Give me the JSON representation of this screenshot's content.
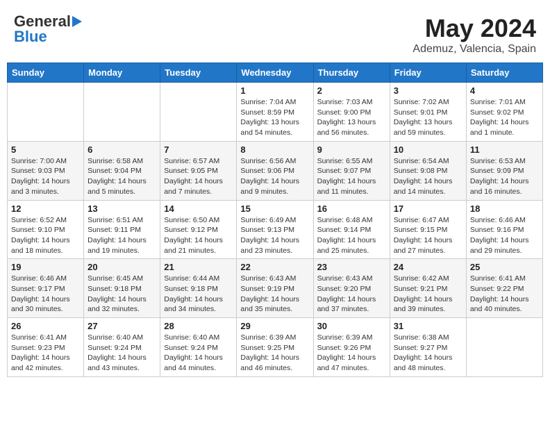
{
  "header": {
    "logo_general": "General",
    "logo_blue": "Blue",
    "month_title": "May 2024",
    "location": "Ademuz, Valencia, Spain"
  },
  "days_of_week": [
    "Sunday",
    "Monday",
    "Tuesday",
    "Wednesday",
    "Thursday",
    "Friday",
    "Saturday"
  ],
  "weeks": [
    [
      {
        "day": "",
        "info": ""
      },
      {
        "day": "",
        "info": ""
      },
      {
        "day": "",
        "info": ""
      },
      {
        "day": "1",
        "info": "Sunrise: 7:04 AM\nSunset: 8:59 PM\nDaylight: 13 hours\nand 54 minutes."
      },
      {
        "day": "2",
        "info": "Sunrise: 7:03 AM\nSunset: 9:00 PM\nDaylight: 13 hours\nand 56 minutes."
      },
      {
        "day": "3",
        "info": "Sunrise: 7:02 AM\nSunset: 9:01 PM\nDaylight: 13 hours\nand 59 minutes."
      },
      {
        "day": "4",
        "info": "Sunrise: 7:01 AM\nSunset: 9:02 PM\nDaylight: 14 hours\nand 1 minute."
      }
    ],
    [
      {
        "day": "5",
        "info": "Sunrise: 7:00 AM\nSunset: 9:03 PM\nDaylight: 14 hours\nand 3 minutes."
      },
      {
        "day": "6",
        "info": "Sunrise: 6:58 AM\nSunset: 9:04 PM\nDaylight: 14 hours\nand 5 minutes."
      },
      {
        "day": "7",
        "info": "Sunrise: 6:57 AM\nSunset: 9:05 PM\nDaylight: 14 hours\nand 7 minutes."
      },
      {
        "day": "8",
        "info": "Sunrise: 6:56 AM\nSunset: 9:06 PM\nDaylight: 14 hours\nand 9 minutes."
      },
      {
        "day": "9",
        "info": "Sunrise: 6:55 AM\nSunset: 9:07 PM\nDaylight: 14 hours\nand 11 minutes."
      },
      {
        "day": "10",
        "info": "Sunrise: 6:54 AM\nSunset: 9:08 PM\nDaylight: 14 hours\nand 14 minutes."
      },
      {
        "day": "11",
        "info": "Sunrise: 6:53 AM\nSunset: 9:09 PM\nDaylight: 14 hours\nand 16 minutes."
      }
    ],
    [
      {
        "day": "12",
        "info": "Sunrise: 6:52 AM\nSunset: 9:10 PM\nDaylight: 14 hours\nand 18 minutes."
      },
      {
        "day": "13",
        "info": "Sunrise: 6:51 AM\nSunset: 9:11 PM\nDaylight: 14 hours\nand 19 minutes."
      },
      {
        "day": "14",
        "info": "Sunrise: 6:50 AM\nSunset: 9:12 PM\nDaylight: 14 hours\nand 21 minutes."
      },
      {
        "day": "15",
        "info": "Sunrise: 6:49 AM\nSunset: 9:13 PM\nDaylight: 14 hours\nand 23 minutes."
      },
      {
        "day": "16",
        "info": "Sunrise: 6:48 AM\nSunset: 9:14 PM\nDaylight: 14 hours\nand 25 minutes."
      },
      {
        "day": "17",
        "info": "Sunrise: 6:47 AM\nSunset: 9:15 PM\nDaylight: 14 hours\nand 27 minutes."
      },
      {
        "day": "18",
        "info": "Sunrise: 6:46 AM\nSunset: 9:16 PM\nDaylight: 14 hours\nand 29 minutes."
      }
    ],
    [
      {
        "day": "19",
        "info": "Sunrise: 6:46 AM\nSunset: 9:17 PM\nDaylight: 14 hours\nand 30 minutes."
      },
      {
        "day": "20",
        "info": "Sunrise: 6:45 AM\nSunset: 9:18 PM\nDaylight: 14 hours\nand 32 minutes."
      },
      {
        "day": "21",
        "info": "Sunrise: 6:44 AM\nSunset: 9:18 PM\nDaylight: 14 hours\nand 34 minutes."
      },
      {
        "day": "22",
        "info": "Sunrise: 6:43 AM\nSunset: 9:19 PM\nDaylight: 14 hours\nand 35 minutes."
      },
      {
        "day": "23",
        "info": "Sunrise: 6:43 AM\nSunset: 9:20 PM\nDaylight: 14 hours\nand 37 minutes."
      },
      {
        "day": "24",
        "info": "Sunrise: 6:42 AM\nSunset: 9:21 PM\nDaylight: 14 hours\nand 39 minutes."
      },
      {
        "day": "25",
        "info": "Sunrise: 6:41 AM\nSunset: 9:22 PM\nDaylight: 14 hours\nand 40 minutes."
      }
    ],
    [
      {
        "day": "26",
        "info": "Sunrise: 6:41 AM\nSunset: 9:23 PM\nDaylight: 14 hours\nand 42 minutes."
      },
      {
        "day": "27",
        "info": "Sunrise: 6:40 AM\nSunset: 9:24 PM\nDaylight: 14 hours\nand 43 minutes."
      },
      {
        "day": "28",
        "info": "Sunrise: 6:40 AM\nSunset: 9:24 PM\nDaylight: 14 hours\nand 44 minutes."
      },
      {
        "day": "29",
        "info": "Sunrise: 6:39 AM\nSunset: 9:25 PM\nDaylight: 14 hours\nand 46 minutes."
      },
      {
        "day": "30",
        "info": "Sunrise: 6:39 AM\nSunset: 9:26 PM\nDaylight: 14 hours\nand 47 minutes."
      },
      {
        "day": "31",
        "info": "Sunrise: 6:38 AM\nSunset: 9:27 PM\nDaylight: 14 hours\nand 48 minutes."
      },
      {
        "day": "",
        "info": ""
      }
    ]
  ]
}
